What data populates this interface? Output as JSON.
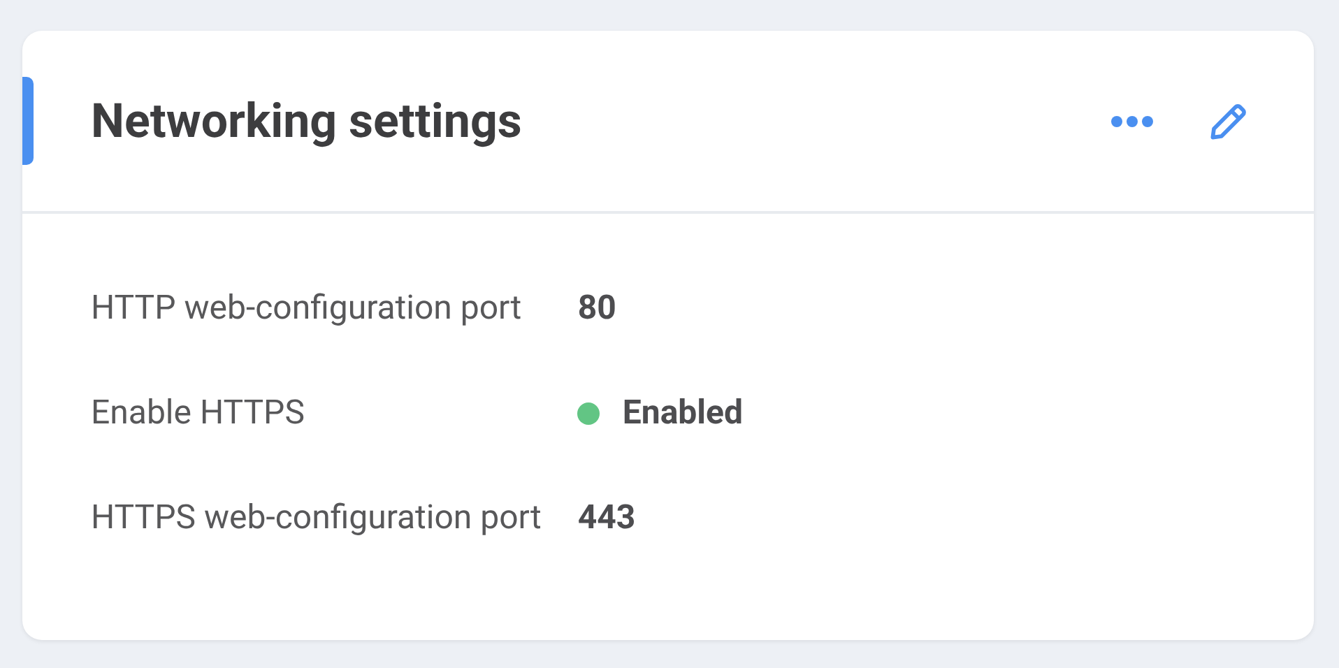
{
  "card": {
    "title": "Networking settings",
    "accent": true
  },
  "settings": [
    {
      "label": "HTTP web-configuration port",
      "kind": "text",
      "value": "80"
    },
    {
      "label": "Enable HTTPS",
      "kind": "status",
      "value": "Enabled",
      "color": "#62c584"
    },
    {
      "label": "HTTPS web-configuration port",
      "kind": "text",
      "value": "443"
    }
  ]
}
